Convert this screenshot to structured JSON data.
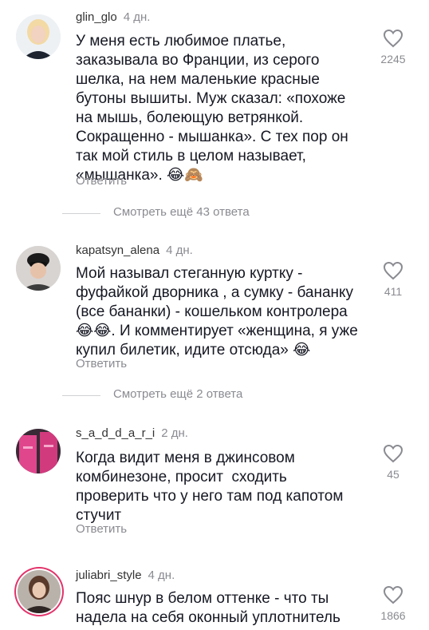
{
  "comments": [
    {
      "username": "glin_glo",
      "date": "4 дн.",
      "text": "У меня есть любимое платье,\nзаказывала во Франции, из серого\nшелка, на нем маленькие красные\nбутоны вышиты. Муж сказал: «похоже\nна мышь, болеющую ветрянкой.\nСокращенно - мышанка». С тех пор он\nтак мой стиль в целом называет,\n«мышанка». 😂🙈",
      "likes": "2245",
      "reply_label": "Ответить"
    },
    {
      "username": "kapatsyn_alena",
      "date": "4 дн.",
      "text": "Мой называл стеганную куртку -\nфуфайкой дворника , а сумку - бананку\n(все бананки) - кошельком контролера\n😂😂. И комментирует «женщина, я уже\nкупил билетик, идите отсюда» 😂",
      "likes": "411",
      "reply_label": "Ответить"
    },
    {
      "username": "s_a_d_d_a_r_i",
      "date": "2 дн.",
      "text": "Когда видит меня в джинсовом\nкомбинезоне, просит  сходить\nпроверить что у него там под капотом\nстучит",
      "likes": "45",
      "reply_label": "Ответить"
    },
    {
      "username": "juliabri_style",
      "date": "4 дн.",
      "text": "Пояс шнур в белом оттенке - что ты\nнадела на себя оконный уплотнитель",
      "likes": "1866"
    }
  ],
  "more_replies": [
    "Смотреть ещё 43 ответа",
    "Смотреть ещё 2 ответа"
  ],
  "icons": {
    "like": "heart-outline-icon"
  },
  "colors": {
    "text": "#161823",
    "muted": "#8a8b91",
    "story_ring": "#e2336b"
  }
}
